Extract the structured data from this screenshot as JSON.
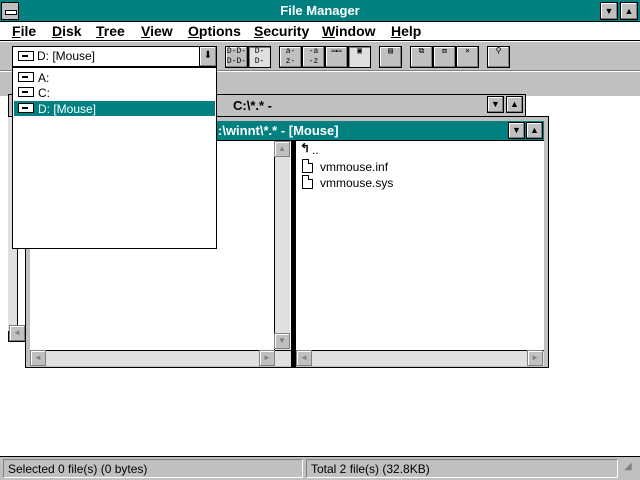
{
  "window": {
    "title": "File Manager"
  },
  "menu": [
    "File",
    "Disk",
    "Tree",
    "View",
    "Options",
    "Security",
    "Window",
    "Help"
  ],
  "drive_selector": {
    "selected": "D: [Mouse]",
    "options": [
      {
        "label": "A:",
        "icon": "floppy-drive-icon"
      },
      {
        "label": "C:",
        "icon": "hard-drive-icon"
      },
      {
        "label": "D: [Mouse]",
        "icon": "removable-drive-icon",
        "selected": true
      }
    ]
  },
  "toolbar": {
    "buttons": [
      "connect-network-drive",
      "disconnect-network-drive",
      "sort-by-name",
      "sort-by-date",
      "copy",
      "move",
      "delete",
      "properties"
    ]
  },
  "background_window": {
    "title": "C:\\*.* -"
  },
  "active_window": {
    "title": ":\\winnt\\*.* - [Mouse]",
    "parent_link": "..",
    "files": [
      "vmmouse.inf",
      "vmmouse.sys"
    ]
  },
  "status": {
    "left": "Selected 0 file(s) (0 bytes)",
    "right": "Total 2 file(s) (32.8KB)"
  },
  "colors": {
    "title_active": "#008080",
    "face": "#c0c0c0",
    "selection": "#008080"
  }
}
